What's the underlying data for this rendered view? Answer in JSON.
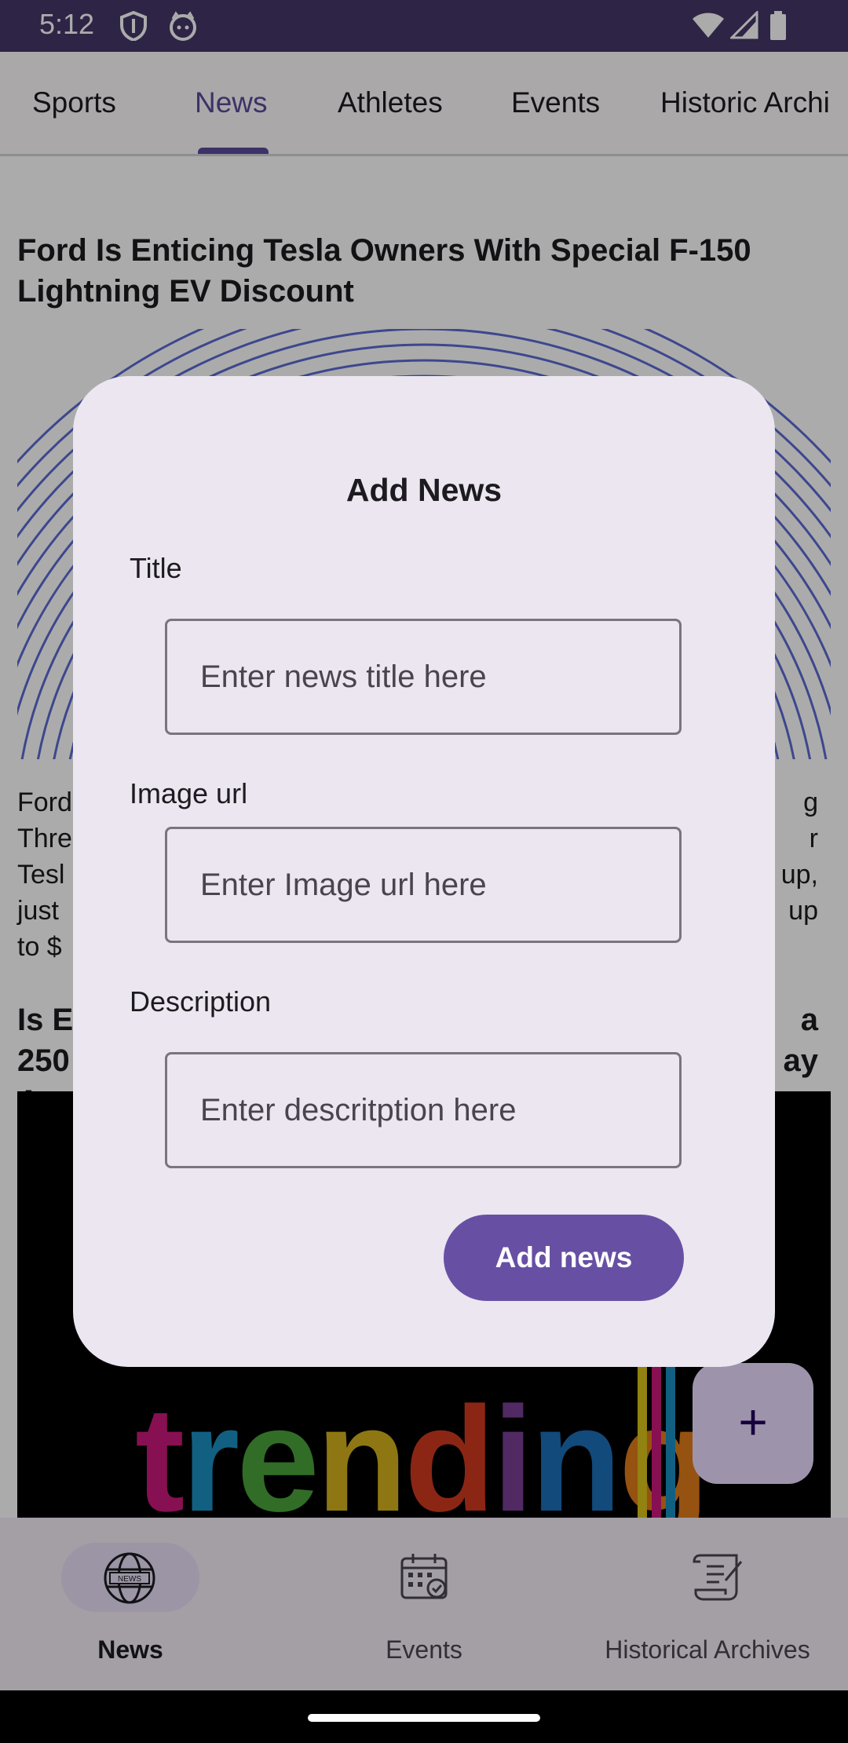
{
  "status_bar": {
    "time": "5:12"
  },
  "tabs": [
    {
      "label": "Sports"
    },
    {
      "label": "News",
      "active": true
    },
    {
      "label": "Athletes"
    },
    {
      "label": "Events"
    },
    {
      "label": "Historic Archi"
    }
  ],
  "feed": {
    "article1": {
      "title": "Ford Is Enticing Tesla Owners With Special F-150 Lightning EV Discount",
      "snippet": [
        "Ford",
        "Three",
        "Tesl",
        "just",
        "to $"
      ],
      "snippet_right": [
        "g",
        "r",
        "up,",
        "up"
      ]
    },
    "article2": {
      "title_lines": [
        "Is E",
        "250",
        "Apr"
      ],
      "title_right": [
        "a",
        "ay"
      ],
      "image_text": "trending"
    }
  },
  "dialog": {
    "title": "Add News",
    "title_label": "Title",
    "title_placeholder": "Enter news title here",
    "image_label": "Image url",
    "image_placeholder": "Enter Image url here",
    "description_label": "Description",
    "description_placeholder": "Enter descritption here",
    "submit_label": "Add news"
  },
  "fab": {
    "label": "+"
  },
  "bottom_nav": [
    {
      "label": "News",
      "icon": "news-globe-icon",
      "active": true
    },
    {
      "label": "Events",
      "icon": "calendar-icon"
    },
    {
      "label": "Historical Archives",
      "icon": "scroll-icon"
    }
  ],
  "colors": {
    "status_bar": "#453668",
    "primary": "#6750a4",
    "dialog_bg": "#ece6f0",
    "nav_active_pill": "#e8def8",
    "fab_bg": "#eaddff"
  }
}
